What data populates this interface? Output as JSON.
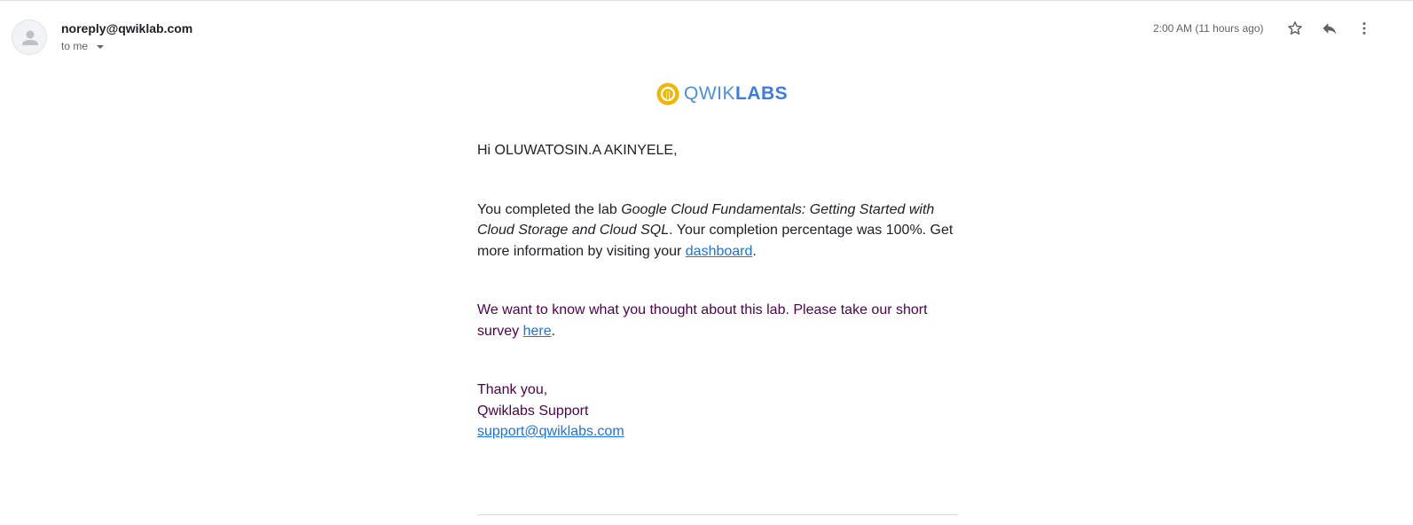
{
  "email": {
    "sender": "noreply@qwiklab.com",
    "recipient_label": "to me",
    "timestamp": "2:00 AM (11 hours ago)"
  },
  "logo": {
    "text_light": "QWIK",
    "text_bold": "LABS"
  },
  "body": {
    "greeting": "Hi OLUWATOSIN.A AKINYELE,",
    "completion_intro": "You completed the lab ",
    "lab_name": "Google Cloud Fundamentals: Getting Started with Cloud Storage and Cloud SQL",
    "completion_rest": ". Your completion percentage was 100%. Get more information by visiting your ",
    "dashboard_link": "dashboard",
    "completion_end": ".",
    "survey_text": "We want to know what you thought about this lab. Please take our short survey ",
    "survey_link": "here",
    "survey_end": ".",
    "signoff": "Thank you,",
    "signature": "Qwiklabs Support",
    "support_email": "support@qwiklabs.com"
  },
  "icons": {
    "avatar": "person-icon",
    "star": "star-icon",
    "reply": "reply-icon",
    "more": "more-vert-icon",
    "logo_mark": "qwiklabs-logo-icon"
  },
  "colors": {
    "link": "#1a73e8",
    "purple_text": "#500050",
    "logo_yellow": "#f4b400",
    "logo_blue": "#4a8fe7"
  }
}
